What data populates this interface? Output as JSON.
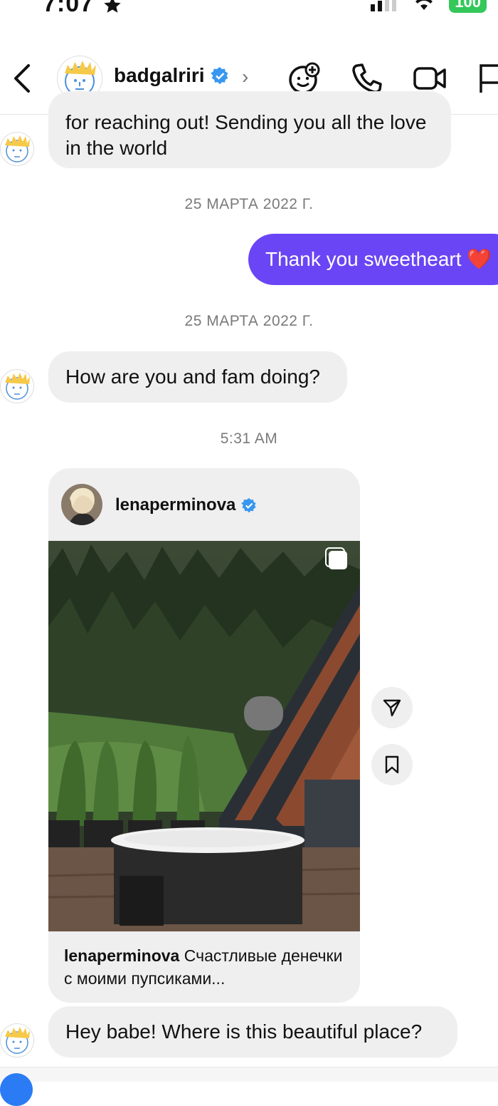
{
  "status_bar": {
    "time": "7:07",
    "battery": "100"
  },
  "header": {
    "username": "badgalriri",
    "chevron": "›",
    "icons": [
      "back-icon",
      "sticker-icon",
      "phone-icon",
      "video-icon",
      "flag-icon"
    ]
  },
  "messages": {
    "incoming_1": "for reaching out! Sending you all the love in the world",
    "timestamp_1": "25 МАРТА 2022 Г.",
    "outgoing_1": "Thank you sweetheart ❤️",
    "timestamp_2": "25 МАРТА 2022 Г.",
    "incoming_2": "How are you and fam doing?",
    "timestamp_3": "5:31 AM",
    "incoming_3": "Hey babe! Where is this beautiful place?"
  },
  "shared_post": {
    "username": "lenaperminova",
    "caption_user": "lenaperminova",
    "caption_text": " Счастливые денечки с моими пупсиками..."
  },
  "colors": {
    "outgoing_bubble": "#6a45f5",
    "incoming_bubble": "#efefef",
    "verified": "#3897f0",
    "battery": "#34c759"
  }
}
